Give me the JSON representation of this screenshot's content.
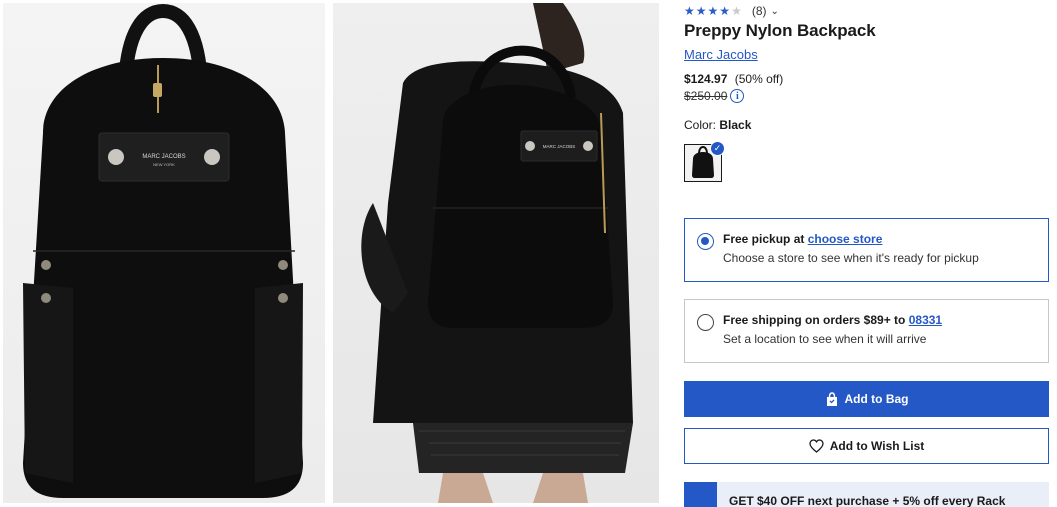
{
  "gallery": {
    "image_1_brand_label": "MARC JACOBS",
    "image_1_brand_sublabel": "NEW YORK",
    "image_2_brand_label": "MARC JACOBS"
  },
  "product": {
    "rating": {
      "stars_filled": 4,
      "stars_total": 5,
      "count": "(8)"
    },
    "title": "Preppy Nylon Backpack",
    "brand": "Marc Jacobs",
    "price": "$124.97",
    "discount": "(50% off)",
    "original_price": "$250.00",
    "info_icon": "i",
    "color_label": "Color:",
    "color_value": "Black"
  },
  "fulfillment": {
    "pickup": {
      "title": "Free pickup at",
      "link": "choose store",
      "subtitle": "Choose a store to see when it's ready for pickup",
      "selected": true
    },
    "shipping": {
      "title": "Free shipping on orders $89+ to",
      "link": "08331",
      "subtitle": "Set a location to see when it will arrive",
      "selected": false
    }
  },
  "actions": {
    "add_to_bag": "Add to Bag",
    "add_to_wish_list": "Add to Wish List"
  },
  "promo": {
    "text": "GET $40 OFF next purchase + 5% off every Rack"
  },
  "colors": {
    "accent": "#2458c6",
    "text": "#1a1a1a",
    "border": "#c7c7c7",
    "star_empty": "#c9c9c9"
  },
  "icons": [
    "star-icon",
    "chevron-down-icon",
    "info-icon",
    "check-icon",
    "bag-icon",
    "heart-icon"
  ]
}
